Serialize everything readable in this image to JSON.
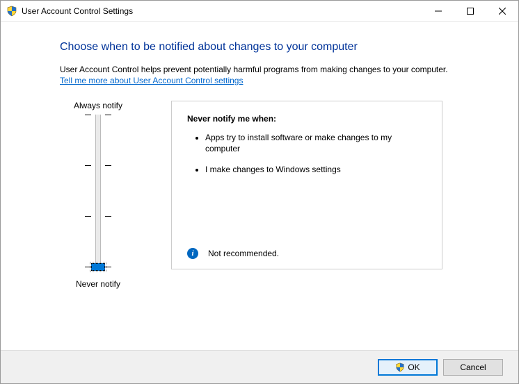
{
  "window": {
    "title": "User Account Control Settings"
  },
  "heading": "Choose when to be notified about changes to your computer",
  "subtext": "User Account Control helps prevent potentially harmful programs from making changes to your computer.",
  "help_link": "Tell me more about User Account Control settings",
  "slider": {
    "top_label": "Always notify",
    "bottom_label": "Never notify",
    "levels": 4,
    "current_level": 0
  },
  "description": {
    "title": "Never notify me when:",
    "bullets": [
      "Apps try to install software or make changes to my computer",
      "I make changes to Windows settings"
    ],
    "footer": "Not recommended."
  },
  "buttons": {
    "ok": "OK",
    "cancel": "Cancel"
  }
}
